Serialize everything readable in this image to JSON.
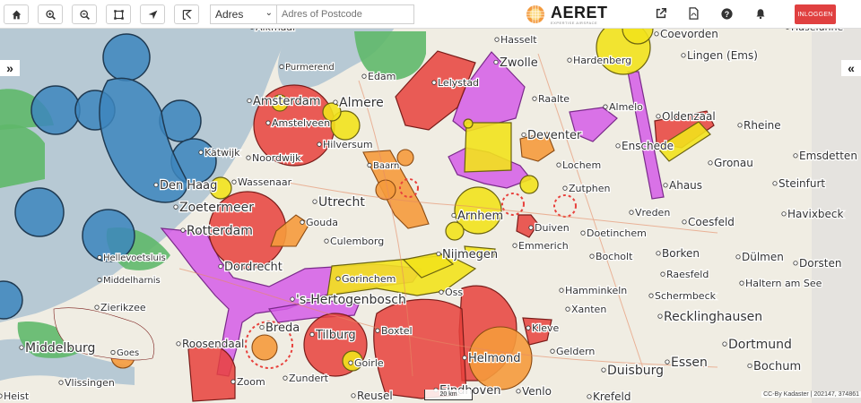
{
  "toolbar": {
    "buttons": [
      {
        "name": "home-button",
        "icon": "home-icon"
      },
      {
        "name": "zoom-in-button",
        "icon": "zoom-in-icon"
      },
      {
        "name": "zoom-out-button",
        "icon": "zoom-out-icon"
      },
      {
        "name": "select-area-button",
        "icon": "select-area-icon"
      },
      {
        "name": "locate-button",
        "icon": "location-arrow-icon"
      },
      {
        "name": "measure-button",
        "icon": "measure-icon"
      }
    ],
    "address_select_value": "Adres",
    "address_placeholder": "Adres of Postcode"
  },
  "logo": {
    "title": "AERET",
    "subtitle": "EXPERTISE AIRSPACE",
    "icon": "sun-logo-icon"
  },
  "header_icons": [
    "external-link-icon",
    "pdf-file-icon",
    "help-icon",
    "bell-icon"
  ],
  "login_label": "INLOGGEN",
  "left_toggle": "»",
  "right_toggle": "«",
  "scale_label": "20 km",
  "attribution": "CC-By Kadaster | 202147, 374861",
  "colors": {
    "water": "#b7c9d4",
    "red_zone": "#e8413c",
    "yellow_zone": "#f2e21c",
    "orange_zone": "#f59a3c",
    "magenta_zone": "#d55ce8",
    "blue_zone": "#3d86bd",
    "green_zone": "#5fb86a",
    "login": "#e04040"
  },
  "places": [
    {
      "name": "Alkmaar"
    },
    {
      "name": "Purmerend"
    },
    {
      "name": "Edam"
    },
    {
      "name": "Lelystad"
    },
    {
      "name": "Zwolle"
    },
    {
      "name": "Hasselt"
    },
    {
      "name": "Coevorden"
    },
    {
      "name": "Hardenberg"
    },
    {
      "name": "Lingen (Ems)"
    },
    {
      "name": "Amsterdam"
    },
    {
      "name": "Almere"
    },
    {
      "name": "Raalte"
    },
    {
      "name": "Almelo"
    },
    {
      "name": "Oldenzaal"
    },
    {
      "name": "Rheine"
    },
    {
      "name": "Amstelveen"
    },
    {
      "name": "Hilversum"
    },
    {
      "name": "Deventer"
    },
    {
      "name": "Enschede"
    },
    {
      "name": "Katwijk"
    },
    {
      "name": "Noordwijk"
    },
    {
      "name": "Baarn"
    },
    {
      "name": "Lochem"
    },
    {
      "name": "Gronau"
    },
    {
      "name": "Emsdetten"
    },
    {
      "name": "Den Haag"
    },
    {
      "name": "Wassenaar"
    },
    {
      "name": "Utrecht"
    },
    {
      "name": "Zutphen"
    },
    {
      "name": "Ahaus"
    },
    {
      "name": "Steinfurt"
    },
    {
      "name": "Zoetermeer"
    },
    {
      "name": "Arnhem"
    },
    {
      "name": "Vreden"
    },
    {
      "name": "Coesfeld"
    },
    {
      "name": "Havixbeck"
    },
    {
      "name": "Rotterdam"
    },
    {
      "name": "Gouda"
    },
    {
      "name": "Duiven"
    },
    {
      "name": "Doetinchem"
    },
    {
      "name": "Hellevoetsluis"
    },
    {
      "name": "Culemborg"
    },
    {
      "name": "Emmerich"
    },
    {
      "name": "Dülmen"
    },
    {
      "name": "Dordrecht"
    },
    {
      "name": "Nijmegen"
    },
    {
      "name": "Bocholt"
    },
    {
      "name": "Borken"
    },
    {
      "name": "Middelharnis"
    },
    {
      "name": "Gorinchem"
    },
    {
      "name": "Raesfeld"
    },
    {
      "name": "Dorsten"
    },
    {
      "name": "Zierikzee"
    },
    {
      "name": "'s-Hertogenbosch"
    },
    {
      "name": "Oss"
    },
    {
      "name": "Hamminkeln"
    },
    {
      "name": "Haltern am See"
    },
    {
      "name": "Schermbeck"
    },
    {
      "name": "Xanten"
    },
    {
      "name": "Recklinghausen"
    },
    {
      "name": "Breda"
    },
    {
      "name": "Tilburg"
    },
    {
      "name": "Boxtel"
    },
    {
      "name": "Kleve"
    },
    {
      "name": "Middelburg"
    },
    {
      "name": "Roosendaal"
    },
    {
      "name": "Helmond"
    },
    {
      "name": "Geldern"
    },
    {
      "name": "Dortmund"
    },
    {
      "name": "Goes"
    },
    {
      "name": "Goirle"
    },
    {
      "name": "Duisburg"
    },
    {
      "name": "Essen"
    },
    {
      "name": "Bochum"
    },
    {
      "name": "Vlissingen"
    },
    {
      "name": "Zundert"
    },
    {
      "name": "Venlo"
    },
    {
      "name": "Krefeld"
    },
    {
      "name": "Reusel"
    },
    {
      "name": "Eindhoven"
    },
    {
      "name": "Zoom"
    },
    {
      "name": "Heist"
    },
    {
      "name": "Haselünne"
    }
  ]
}
